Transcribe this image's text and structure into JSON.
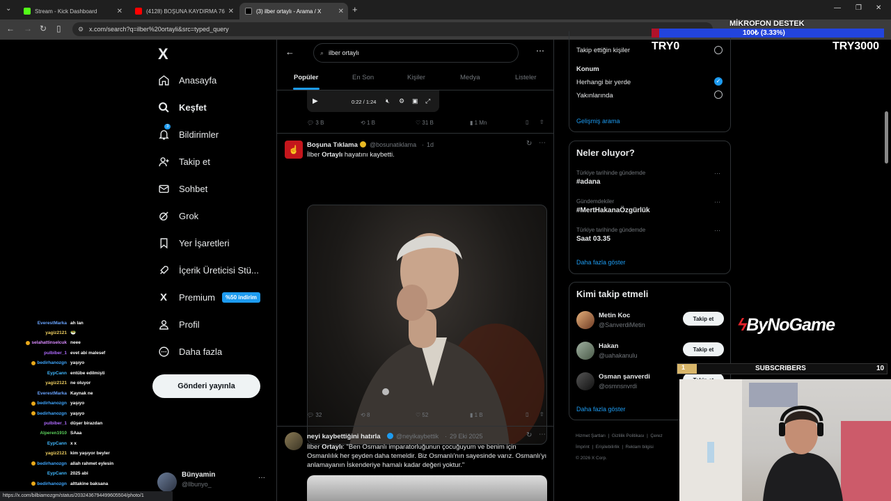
{
  "browser": {
    "tabs": [
      {
        "title": "Stream - Kick Dashboard",
        "favicon_color": "#53fc18"
      },
      {
        "title": "(4128) BOŞUNA KAYDIRMA 76",
        "favicon_color": "#ff0000"
      },
      {
        "title": "(3) ilber ortaylı - Arama / X",
        "favicon_color": "#000000"
      }
    ],
    "new_tab": "+",
    "url": "x.com/search?q=ilber%20ortayli&src=typed_query",
    "status_url": "https://x.com/bilbiamozgm/status/2032436794499605504/photo/1"
  },
  "nav": {
    "logo": "X",
    "items": [
      {
        "label": "Anasayfa",
        "icon": "home-icon"
      },
      {
        "label": "Keşfet",
        "icon": "search-icon"
      },
      {
        "label": "Bildirimler",
        "icon": "bell-icon",
        "badge": "3"
      },
      {
        "label": "Takip et",
        "icon": "follow-icon"
      },
      {
        "label": "Sohbet",
        "icon": "mail-icon"
      },
      {
        "label": "Grok",
        "icon": "grok-icon"
      },
      {
        "label": "Yer İşaretleri",
        "icon": "bookmark-icon"
      },
      {
        "label": "İçerik Üreticisi Stü...",
        "icon": "rocket-icon"
      },
      {
        "label": "Premium",
        "icon": "x-icon",
        "badge": "%50 indirim"
      },
      {
        "label": "Profil",
        "icon": "person-icon"
      },
      {
        "label": "Daha fazla",
        "icon": "more-circle-icon"
      }
    ],
    "post_button": "Gönderi yayınla",
    "account": {
      "name": "Bünyamin",
      "handle": "@llbunyo_",
      "more": "···"
    }
  },
  "search": {
    "query": "ilber ortaylı",
    "tabs": [
      "Popüler",
      "En Son",
      "Kişiler",
      "Medya",
      "Listeler"
    ],
    "active_tab": "Popüler"
  },
  "video": {
    "time": "0:22 / 1:24"
  },
  "tweets": [
    {
      "stats": {
        "replies": "3 B",
        "retweets": "1 B",
        "likes": "31 B",
        "views": "1 Mn"
      }
    },
    {
      "author": "Boşuna Tıklama",
      "handle": "@bosunatiklama",
      "time": "1d",
      "text_pre": "İlber ",
      "text_bold": "Ortaylı",
      "text_post": " hayatını kaybetti.",
      "stats": {
        "replies": "32",
        "retweets": "8",
        "likes": "52",
        "views": "1 B"
      }
    },
    {
      "author": "neyi kaybettiğini hatırla",
      "handle": "@neyikaybettik",
      "time": "29 Eki 2025",
      "text_pre": "İlber ",
      "text_bold": "Ortaylı",
      "text_post": ": \"Ben Osmanlı imparatorluğunun çocuğuyum ve benim için Osmanlılık her şeyden daha temeldir. Biz Osmanlı'nın sayesinde varız. Osmanlı'yı anlamayanın İskenderiye hamalı kadar değeri yoktur.\""
    }
  ],
  "filters": {
    "people_option": "Takip ettiğin kişiler",
    "location_title": "Konum",
    "location_options": [
      "Herhangi bir yerde",
      "Yakınlarında"
    ],
    "advanced": "Gelişmiş arama"
  },
  "trends": {
    "title": "Neler oluyor?",
    "items": [
      {
        "context": "Türkiye tarihinde gündemde",
        "name": "#adana"
      },
      {
        "context": "Gündemdekiler",
        "name": "#MertHakanaÖzgürlük"
      },
      {
        "context": "Türkiye tarihinde gündemde",
        "name": "Saat 03.35"
      }
    ],
    "more": "Daha fazla göster"
  },
  "who_to_follow": {
    "title": "Kimi takip etmeli",
    "items": [
      {
        "name": "Metin Koc",
        "handle": "@SanverdiMetin",
        "button": "Takip et"
      },
      {
        "name": "Hakan",
        "handle": "@uahakanulu",
        "button": "Takip et"
      },
      {
        "name": "Osman şanverdi",
        "handle": "@osmnsnvrdi",
        "button": "Takip et"
      }
    ],
    "more": "Daha fazla göster"
  },
  "footer": {
    "links": [
      "Hizmet Şartları",
      "Gizlilik Politikası",
      "Çerez",
      "İmprint",
      "Erişilebilirlik",
      "Reklam bilgisi"
    ],
    "copyright": "© 2026 X Corp."
  },
  "overlay": {
    "goal_title": "MİKROFON DESTEK",
    "goal_progress": "100₺ (3.33%)",
    "goal_fraction": 0.0333,
    "goal_left": "TRY0",
    "goal_right": "TRY3000",
    "brand": "ByNoGame",
    "subs_index": "1",
    "subs_label": "SUBSCRIBERS",
    "subs_count": "10"
  },
  "chat": [
    {
      "user": "EverestMarka",
      "msg": "ah lan",
      "color": "#6aa5ff"
    },
    {
      "user": "yagiz2121",
      "msg": "🥗",
      "color": "#f0d060"
    },
    {
      "user": "selahattinselcuk",
      "msg": "neee",
      "color": "#d98bff",
      "badge": true
    },
    {
      "user": "pulbiber_1",
      "msg": "evet abi malesef",
      "color": "#b06bff"
    },
    {
      "user": "bedirhanozgn",
      "msg": "yaşıyo",
      "color": "#3fa7ff",
      "badge": true
    },
    {
      "user": "EypCann",
      "msg": "entübe edilmişti",
      "color": "#40b8ff"
    },
    {
      "user": "yagiz2121",
      "msg": "ne oluyor",
      "color": "#f0d060"
    },
    {
      "user": "EverestMarka",
      "msg": "Kaynak ne",
      "color": "#6aa5ff"
    },
    {
      "user": "bedirhanozgn",
      "msg": "yaşıyo",
      "color": "#3fa7ff",
      "badge": true
    },
    {
      "user": "bedirhanozgn",
      "msg": "yaşıyo",
      "color": "#3fa7ff",
      "badge": true
    },
    {
      "user": "pulbiber_1",
      "msg": "düşer birazdan",
      "color": "#b06bff"
    },
    {
      "user": "Alperen1910",
      "msg": "SAaa",
      "color": "#5bd15b"
    },
    {
      "user": "EypCann",
      "msg": "x x",
      "color": "#40b8ff"
    },
    {
      "user": "yagiz2121",
      "msg": "kim yaşıyor beyler",
      "color": "#f0d060"
    },
    {
      "user": "bedirhanozgn",
      "msg": "allah rahmet eylesin",
      "color": "#3fa7ff",
      "badge": true
    },
    {
      "user": "EypCann",
      "msg": "2025 abi",
      "color": "#40b8ff"
    },
    {
      "user": "bedirhanozgn",
      "msg": "alttakine baksana",
      "color": "#3fa7ff",
      "badge": true
    },
    {
      "user": "bedirhanozgn",
      "msg": "mal abim",
      "color": "#3fa7ff",
      "badge": true
    }
  ],
  "colors": {
    "accent": "#1d9bf0",
    "bg": "#000000",
    "border": "#2f3336",
    "muted": "#71767b"
  }
}
